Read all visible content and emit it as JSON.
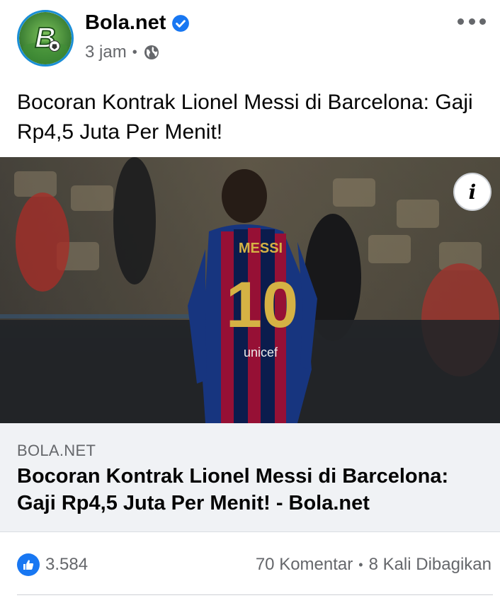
{
  "post": {
    "page_name": "Bola.net",
    "time": "3 jam",
    "separator": "•",
    "text": "Bocoran Kontrak Lionel Messi di Barcelona: Gaji Rp4,5 Juta Per Menit!",
    "icons": {
      "avatar": "bola-net-logo",
      "verified": "verified-badge-icon",
      "audience": "globe-icon",
      "more": "more-options-icon",
      "info": "info-icon",
      "reaction": "like-icon"
    }
  },
  "photo": {
    "jersey_name": "MESSI",
    "jersey_number": "10",
    "sponsor": "unicef"
  },
  "link_preview": {
    "domain": "BOLA.NET",
    "title": "Bocoran Kontrak Lionel Messi di Barcelona: Gaji Rp4,5 Juta Per Menit! - Bola.net",
    "info_glyph": "i"
  },
  "engagement": {
    "likes": "3.584",
    "comments": "70 Komentar",
    "separator": "•",
    "shares": "8 Kali Dibagikan"
  },
  "colors": {
    "facebook_blue": "#1877f2",
    "secondary_text": "#65676b",
    "link_box_bg": "#f0f2f5"
  }
}
